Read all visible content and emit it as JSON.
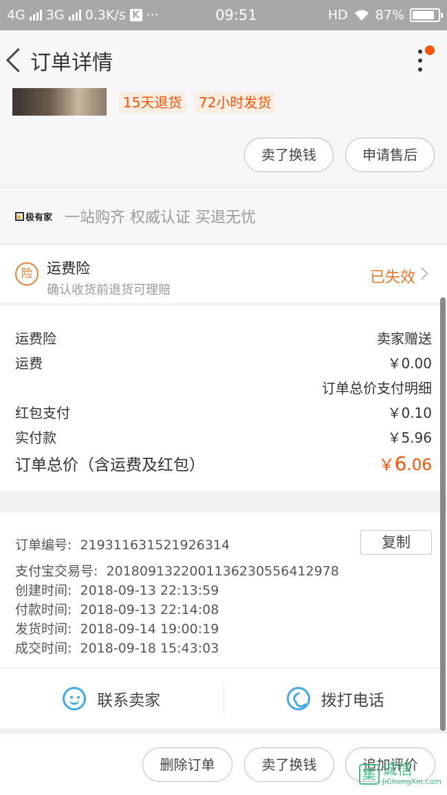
{
  "status_bar": {
    "network1": "4G",
    "network2": "3G",
    "speed": "0.3K/s",
    "k": "K",
    "more": "···",
    "time": "09:51",
    "hd": "HD",
    "battery": "87%",
    "battery_level": 0.87
  },
  "header": {
    "title": "订单详情"
  },
  "product": {
    "tags": [
      "15天退货",
      "72小时发货"
    ],
    "buttons": [
      "卖了换钱",
      "申请售后"
    ]
  },
  "brand": {
    "name": "极有家",
    "slogan": "一站购齐 权威认证 买退无忧"
  },
  "insurance": {
    "badge": "险",
    "title": "运费险",
    "subtitle": "确认收货前退货可理赔",
    "status": "已失效"
  },
  "price": {
    "rows": [
      {
        "label": "运费险",
        "value": "卖家赠送"
      },
      {
        "label": "运费",
        "value": "￥0.00"
      },
      {
        "label": "",
        "value": "订单总价支付明细"
      },
      {
        "label": "红包支付",
        "value": "￥0.10"
      },
      {
        "label": "实付款",
        "value": "￥5.96"
      }
    ],
    "total_label": "订单总价（含运费及红包）",
    "total_currency": "￥",
    "total_int": "6",
    "total_dec": ".06"
  },
  "order": {
    "number_label": "订单编号:",
    "number": "219311631521926314",
    "copy": "复制",
    "alipay_label": "支付宝交易号:",
    "alipay": "2018091322001136230556412978",
    "times": [
      {
        "label": "创建时间:",
        "value": "2018-09-13 22:13:59"
      },
      {
        "label": "付款时间:",
        "value": "2018-09-13 22:14:08"
      },
      {
        "label": "发货时间:",
        "value": "2018-09-14 19:00:19"
      },
      {
        "label": "成交时间:",
        "value": "2018-09-18 15:43:03"
      }
    ]
  },
  "contact": {
    "seller": "联系卖家",
    "phone": "拨打电话"
  },
  "bottom": {
    "buttons": [
      "删除订单",
      "卖了换钱",
      "追加评价"
    ]
  },
  "watermark": {
    "mark": "集",
    "cn": "诚信",
    "en": "JiChengXin.com"
  }
}
